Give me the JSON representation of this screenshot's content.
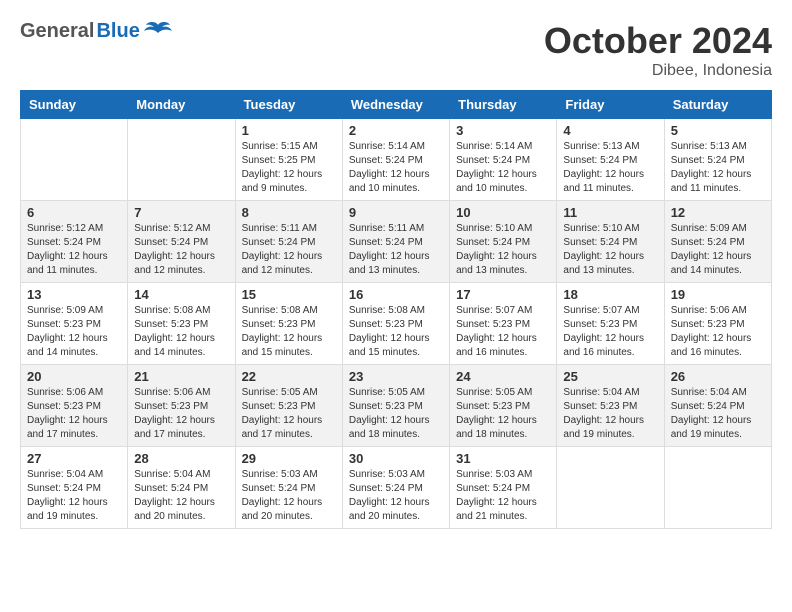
{
  "header": {
    "logo": {
      "general": "General",
      "blue": "Blue"
    },
    "title": "October 2024",
    "location": "Dibee, Indonesia"
  },
  "calendar": {
    "days_of_week": [
      "Sunday",
      "Monday",
      "Tuesday",
      "Wednesday",
      "Thursday",
      "Friday",
      "Saturday"
    ],
    "weeks": [
      [
        {
          "day": "",
          "sunrise": "",
          "sunset": "",
          "daylight": ""
        },
        {
          "day": "",
          "sunrise": "",
          "sunset": "",
          "daylight": ""
        },
        {
          "day": "1",
          "sunrise": "Sunrise: 5:15 AM",
          "sunset": "Sunset: 5:25 PM",
          "daylight": "Daylight: 12 hours and 9 minutes."
        },
        {
          "day": "2",
          "sunrise": "Sunrise: 5:14 AM",
          "sunset": "Sunset: 5:24 PM",
          "daylight": "Daylight: 12 hours and 10 minutes."
        },
        {
          "day": "3",
          "sunrise": "Sunrise: 5:14 AM",
          "sunset": "Sunset: 5:24 PM",
          "daylight": "Daylight: 12 hours and 10 minutes."
        },
        {
          "day": "4",
          "sunrise": "Sunrise: 5:13 AM",
          "sunset": "Sunset: 5:24 PM",
          "daylight": "Daylight: 12 hours and 11 minutes."
        },
        {
          "day": "5",
          "sunrise": "Sunrise: 5:13 AM",
          "sunset": "Sunset: 5:24 PM",
          "daylight": "Daylight: 12 hours and 11 minutes."
        }
      ],
      [
        {
          "day": "6",
          "sunrise": "Sunrise: 5:12 AM",
          "sunset": "Sunset: 5:24 PM",
          "daylight": "Daylight: 12 hours and 11 minutes."
        },
        {
          "day": "7",
          "sunrise": "Sunrise: 5:12 AM",
          "sunset": "Sunset: 5:24 PM",
          "daylight": "Daylight: 12 hours and 12 minutes."
        },
        {
          "day": "8",
          "sunrise": "Sunrise: 5:11 AM",
          "sunset": "Sunset: 5:24 PM",
          "daylight": "Daylight: 12 hours and 12 minutes."
        },
        {
          "day": "9",
          "sunrise": "Sunrise: 5:11 AM",
          "sunset": "Sunset: 5:24 PM",
          "daylight": "Daylight: 12 hours and 13 minutes."
        },
        {
          "day": "10",
          "sunrise": "Sunrise: 5:10 AM",
          "sunset": "Sunset: 5:24 PM",
          "daylight": "Daylight: 12 hours and 13 minutes."
        },
        {
          "day": "11",
          "sunrise": "Sunrise: 5:10 AM",
          "sunset": "Sunset: 5:24 PM",
          "daylight": "Daylight: 12 hours and 13 minutes."
        },
        {
          "day": "12",
          "sunrise": "Sunrise: 5:09 AM",
          "sunset": "Sunset: 5:24 PM",
          "daylight": "Daylight: 12 hours and 14 minutes."
        }
      ],
      [
        {
          "day": "13",
          "sunrise": "Sunrise: 5:09 AM",
          "sunset": "Sunset: 5:23 PM",
          "daylight": "Daylight: 12 hours and 14 minutes."
        },
        {
          "day": "14",
          "sunrise": "Sunrise: 5:08 AM",
          "sunset": "Sunset: 5:23 PM",
          "daylight": "Daylight: 12 hours and 14 minutes."
        },
        {
          "day": "15",
          "sunrise": "Sunrise: 5:08 AM",
          "sunset": "Sunset: 5:23 PM",
          "daylight": "Daylight: 12 hours and 15 minutes."
        },
        {
          "day": "16",
          "sunrise": "Sunrise: 5:08 AM",
          "sunset": "Sunset: 5:23 PM",
          "daylight": "Daylight: 12 hours and 15 minutes."
        },
        {
          "day": "17",
          "sunrise": "Sunrise: 5:07 AM",
          "sunset": "Sunset: 5:23 PM",
          "daylight": "Daylight: 12 hours and 16 minutes."
        },
        {
          "day": "18",
          "sunrise": "Sunrise: 5:07 AM",
          "sunset": "Sunset: 5:23 PM",
          "daylight": "Daylight: 12 hours and 16 minutes."
        },
        {
          "day": "19",
          "sunrise": "Sunrise: 5:06 AM",
          "sunset": "Sunset: 5:23 PM",
          "daylight": "Daylight: 12 hours and 16 minutes."
        }
      ],
      [
        {
          "day": "20",
          "sunrise": "Sunrise: 5:06 AM",
          "sunset": "Sunset: 5:23 PM",
          "daylight": "Daylight: 12 hours and 17 minutes."
        },
        {
          "day": "21",
          "sunrise": "Sunrise: 5:06 AM",
          "sunset": "Sunset: 5:23 PM",
          "daylight": "Daylight: 12 hours and 17 minutes."
        },
        {
          "day": "22",
          "sunrise": "Sunrise: 5:05 AM",
          "sunset": "Sunset: 5:23 PM",
          "daylight": "Daylight: 12 hours and 17 minutes."
        },
        {
          "day": "23",
          "sunrise": "Sunrise: 5:05 AM",
          "sunset": "Sunset: 5:23 PM",
          "daylight": "Daylight: 12 hours and 18 minutes."
        },
        {
          "day": "24",
          "sunrise": "Sunrise: 5:05 AM",
          "sunset": "Sunset: 5:23 PM",
          "daylight": "Daylight: 12 hours and 18 minutes."
        },
        {
          "day": "25",
          "sunrise": "Sunrise: 5:04 AM",
          "sunset": "Sunset: 5:23 PM",
          "daylight": "Daylight: 12 hours and 19 minutes."
        },
        {
          "day": "26",
          "sunrise": "Sunrise: 5:04 AM",
          "sunset": "Sunset: 5:24 PM",
          "daylight": "Daylight: 12 hours and 19 minutes."
        }
      ],
      [
        {
          "day": "27",
          "sunrise": "Sunrise: 5:04 AM",
          "sunset": "Sunset: 5:24 PM",
          "daylight": "Daylight: 12 hours and 19 minutes."
        },
        {
          "day": "28",
          "sunrise": "Sunrise: 5:04 AM",
          "sunset": "Sunset: 5:24 PM",
          "daylight": "Daylight: 12 hours and 20 minutes."
        },
        {
          "day": "29",
          "sunrise": "Sunrise: 5:03 AM",
          "sunset": "Sunset: 5:24 PM",
          "daylight": "Daylight: 12 hours and 20 minutes."
        },
        {
          "day": "30",
          "sunrise": "Sunrise: 5:03 AM",
          "sunset": "Sunset: 5:24 PM",
          "daylight": "Daylight: 12 hours and 20 minutes."
        },
        {
          "day": "31",
          "sunrise": "Sunrise: 5:03 AM",
          "sunset": "Sunset: 5:24 PM",
          "daylight": "Daylight: 12 hours and 21 minutes."
        },
        {
          "day": "",
          "sunrise": "",
          "sunset": "",
          "daylight": ""
        },
        {
          "day": "",
          "sunrise": "",
          "sunset": "",
          "daylight": ""
        }
      ]
    ]
  }
}
